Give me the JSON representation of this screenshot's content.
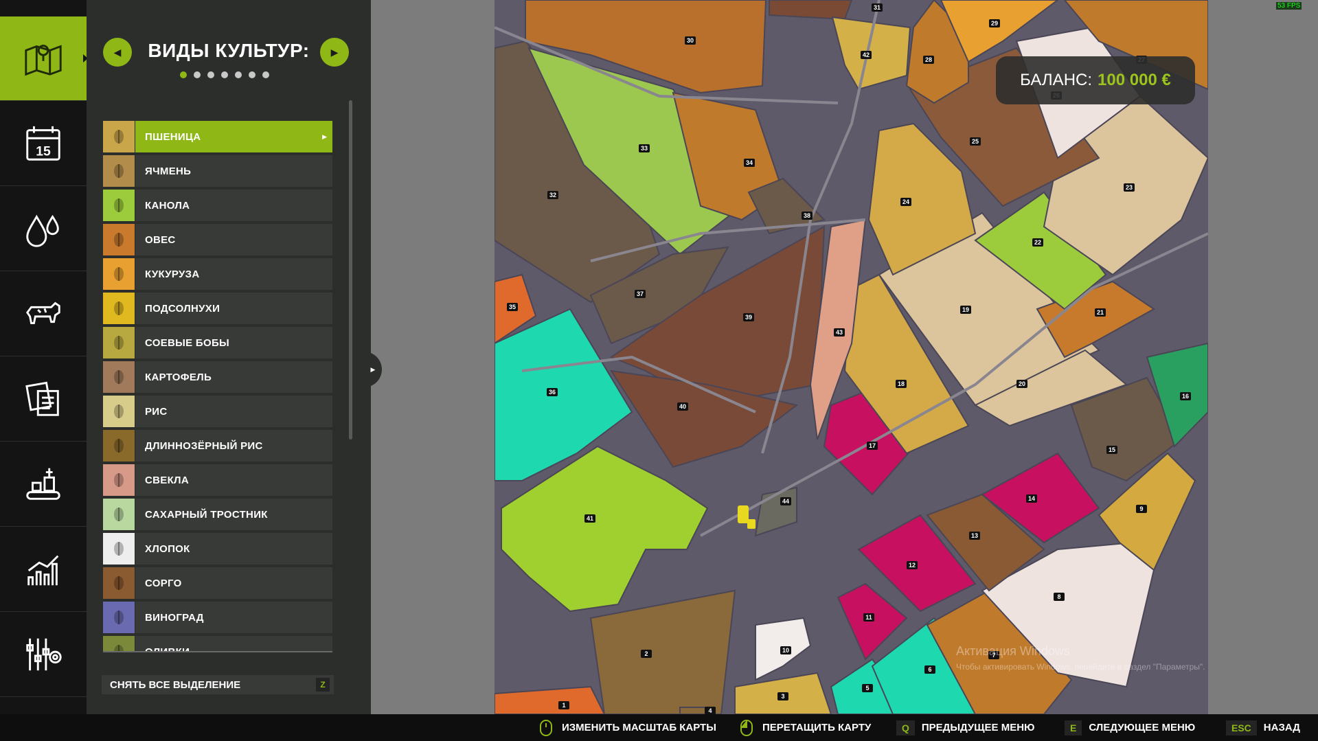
{
  "sidebar": {
    "icons": [
      "map-icon",
      "calendar-icon",
      "water-drops-icon",
      "cow-icon",
      "contracts-icon",
      "production-icon",
      "statistics-icon",
      "settings-icon"
    ],
    "calendar_day": "15"
  },
  "panel": {
    "title": "ВИДЫ КУЛЬТУР:",
    "page_dots": 7,
    "active_dot": 0,
    "crops": [
      {
        "label": "ПШЕНИЦА",
        "color": "#caa64a",
        "selected": true
      },
      {
        "label": "ЯЧМЕНЬ",
        "color": "#b28c4a"
      },
      {
        "label": "КАНОЛА",
        "color": "#9ccc3c"
      },
      {
        "label": "ОВЕС",
        "color": "#c97a2c"
      },
      {
        "label": "КУКУРУЗА",
        "color": "#e8a030"
      },
      {
        "label": "ПОДСОЛНУХИ",
        "color": "#e0b820"
      },
      {
        "label": "СОЕВЫЕ БОБЫ",
        "color": "#b8a840"
      },
      {
        "label": "КАРТОФЕЛЬ",
        "color": "#a07a5a"
      },
      {
        "label": "РИС",
        "color": "#d8cc8a"
      },
      {
        "label": "ДЛИННОЗЁРНЫЙ РИС",
        "color": "#8a6a2a"
      },
      {
        "label": "СВЕКЛА",
        "color": "#d89a88"
      },
      {
        "label": "САХАРНЫЙ ТРОСТНИК",
        "color": "#b8d8a0"
      },
      {
        "label": "ХЛОПОК",
        "color": "#eeeeee"
      },
      {
        "label": "СОРГО",
        "color": "#8a5a30"
      },
      {
        "label": "ВИНОГРАД",
        "color": "#6a6ab0"
      },
      {
        "label": "ОЛИВКИ",
        "color": "#7a8a3a"
      }
    ],
    "clear_label": "СНЯТЬ ВСЕ ВЫДЕЛЕНИЕ",
    "clear_key": "Z"
  },
  "map": {
    "balance_label": "БАЛАНС:",
    "balance_value": "100 000 €",
    "fields": [
      {
        "n": "1",
        "c": "#e06a2c"
      },
      {
        "n": "2",
        "c": "#8a6a3a"
      },
      {
        "n": "3",
        "c": "#d4b048"
      },
      {
        "n": "4",
        "c": "#8a6a3a"
      },
      {
        "n": "5",
        "c": "#1ed8b0"
      },
      {
        "n": "6",
        "c": "#1ed8b0"
      },
      {
        "n": "7",
        "c": "#c07a2c"
      },
      {
        "n": "8",
        "c": "#efe3e0"
      },
      {
        "n": "9",
        "c": "#d4aa40"
      },
      {
        "n": "10",
        "c": "#f2ecea"
      },
      {
        "n": "11",
        "c": "#c81060"
      },
      {
        "n": "12",
        "c": "#c81060"
      },
      {
        "n": "13",
        "c": "#8a5a34"
      },
      {
        "n": "14",
        "c": "#c81060"
      },
      {
        "n": "15",
        "c": "#6b5a4a"
      },
      {
        "n": "16",
        "c": "#2aa060"
      },
      {
        "n": "17",
        "c": "#c81060"
      },
      {
        "n": "18",
        "c": "#d4aa48"
      },
      {
        "n": "19",
        "c": "#dcc49c"
      },
      {
        "n": "20",
        "c": "#dcc49c"
      },
      {
        "n": "21",
        "c": "#c87a2c"
      },
      {
        "n": "22",
        "c": "#9ccc3c"
      },
      {
        "n": "23",
        "c": "#dcc49c"
      },
      {
        "n": "24",
        "c": "#d4aa48"
      },
      {
        "n": "25",
        "c": "#8a5a3a"
      },
      {
        "n": "26",
        "c": "#efe3e0"
      },
      {
        "n": "27",
        "c": "#c07a2c"
      },
      {
        "n": "28",
        "c": "#c07a2c"
      },
      {
        "n": "29",
        "c": "#e8a030"
      },
      {
        "n": "30",
        "c": "#b8702c"
      },
      {
        "n": "31",
        "c": "#7a4a34"
      },
      {
        "n": "32",
        "c": "#6b5a4a"
      },
      {
        "n": "33",
        "c": "#9cc850"
      },
      {
        "n": "34",
        "c": "#c07a2c"
      },
      {
        "n": "35",
        "c": "#e06a2c"
      },
      {
        "n": "36",
        "c": "#1ed8b0"
      },
      {
        "n": "37",
        "c": "#6b5a4a"
      },
      {
        "n": "38",
        "c": "#6b5a4a"
      },
      {
        "n": "39",
        "c": "#7a4a38"
      },
      {
        "n": "40",
        "c": "#7a4a38"
      },
      {
        "n": "41",
        "c": "#a0d030"
      },
      {
        "n": "42",
        "c": "#d4b048"
      },
      {
        "n": "43",
        "c": "#e0a088"
      },
      {
        "n": "44",
        "c": "#6b6a60"
      }
    ]
  },
  "watermark": {
    "line1": "Активация Windows",
    "line2": "Чтобы активировать Windows, перейдите в раздел \"Параметры\"."
  },
  "fps": "53 FPS",
  "bottom_hints": [
    {
      "key": "",
      "icon": "mouse-wheel-icon",
      "label": "ИЗМЕНИТЬ МАСШТАБ КАРТЫ"
    },
    {
      "key": "",
      "icon": "mouse-left-icon",
      "label": "ПЕРЕТАЩИТЬ КАРТУ"
    },
    {
      "key": "Q",
      "label": "ПРЕДЫДУЩЕЕ МЕНЮ"
    },
    {
      "key": "E",
      "label": "СЛЕДУЮЩЕЕ МЕНЮ"
    },
    {
      "key": "ESC",
      "label": "НАЗАД"
    }
  ]
}
